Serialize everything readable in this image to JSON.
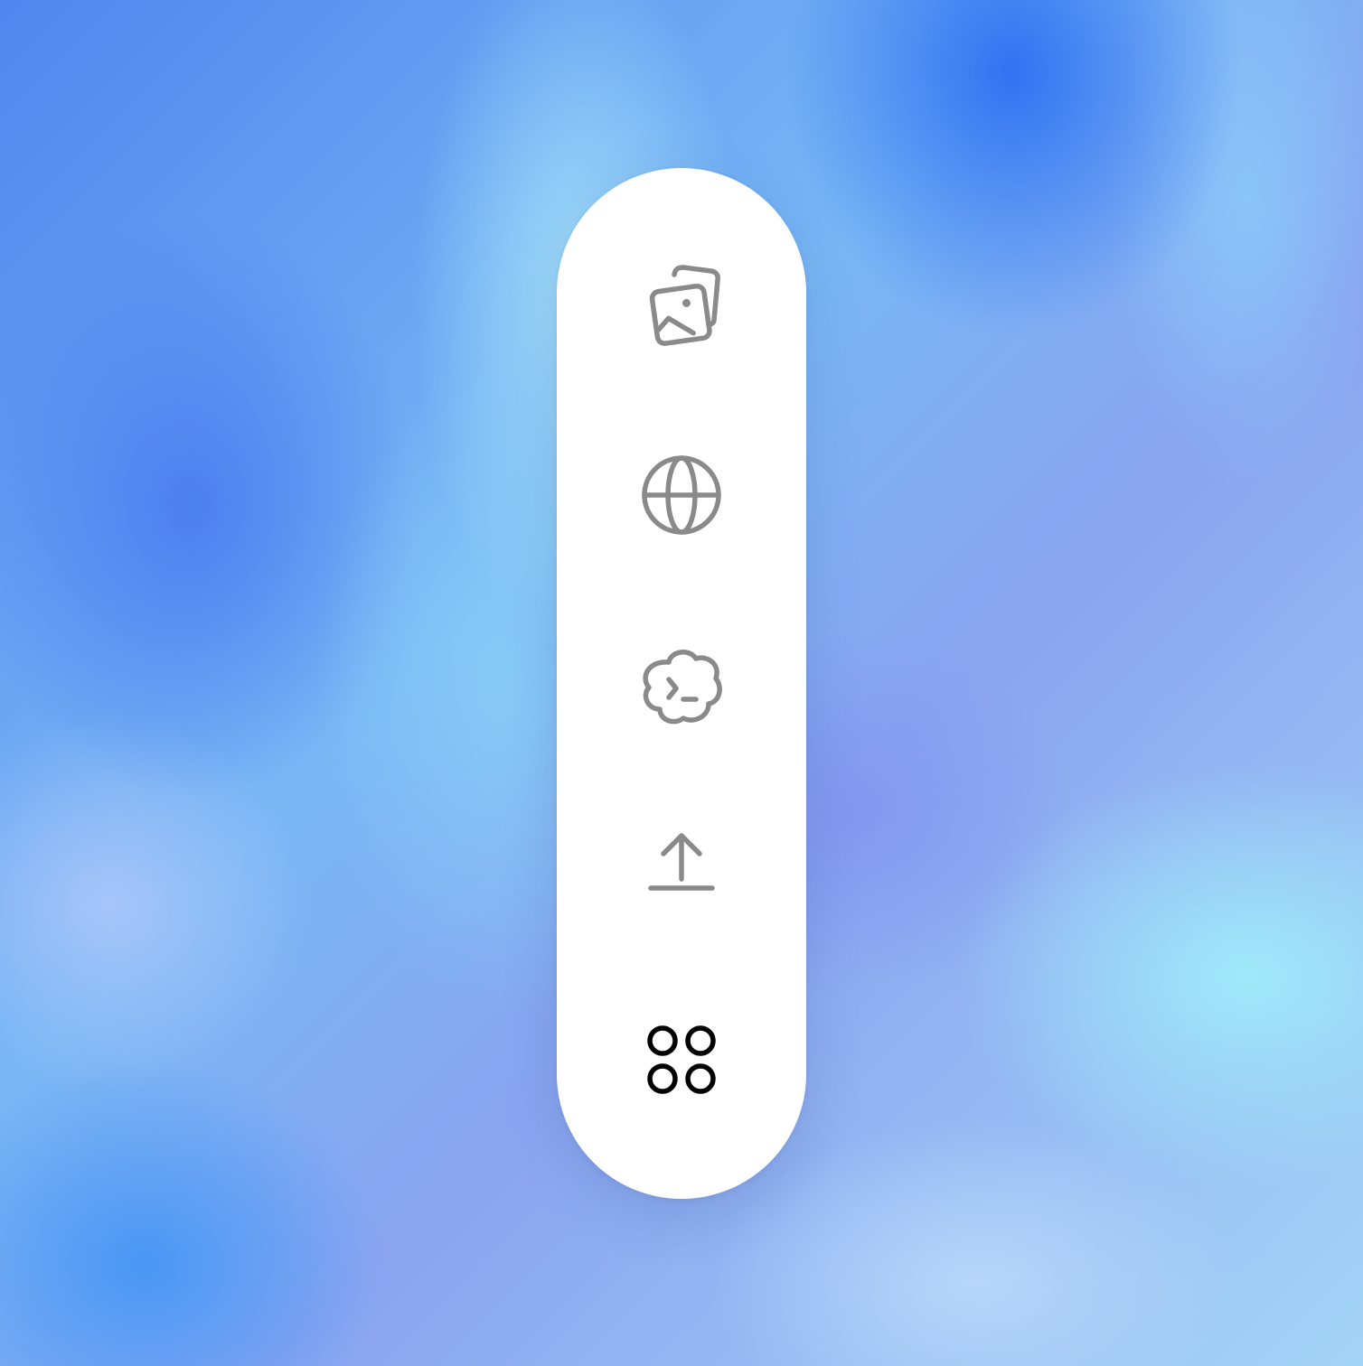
{
  "background": {
    "style": "blue gradient"
  },
  "toolbar": {
    "color": "#ffffff",
    "icon_color": "#8a8a8a",
    "active_icon_color": "#000000",
    "items": [
      {
        "icon": "images-icon",
        "label": ""
      },
      {
        "icon": "globe-icon",
        "label": ""
      },
      {
        "icon": "cloud-terminal-icon",
        "label": ""
      },
      {
        "icon": "upload-icon",
        "label": ""
      },
      {
        "icon": "apps-grid-icon",
        "label": "",
        "active": true
      }
    ]
  }
}
